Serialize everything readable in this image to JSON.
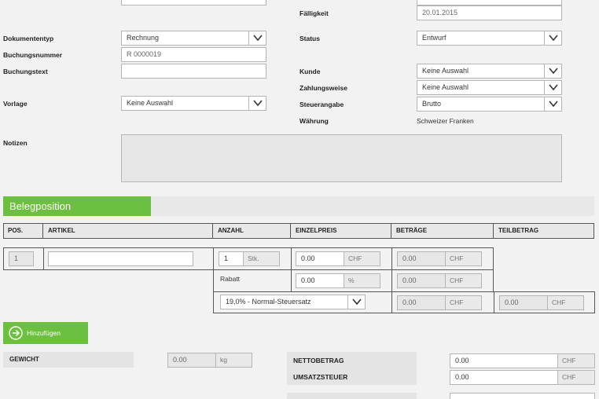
{
  "top": {
    "faelligkeit_label": "Fälligkeit",
    "faelligkeit_value": "20.01.2015"
  },
  "left_form": {
    "dokumententyp_label": "Dokumententyp",
    "dokumententyp_value": "Rechnung",
    "buchungsnummer_label": "Buchungsnummer",
    "buchungsnummer_value": "R 0000019",
    "buchungstext_label": "Buchungstext",
    "buchungstext_value": "",
    "vorlage_label": "Vorlage",
    "vorlage_value": "Keine Auswahl"
  },
  "right_form": {
    "status_label": "Status",
    "status_value": "Entwurf",
    "kunde_label": "Kunde",
    "kunde_value": "Keine Auswahl",
    "zahlungsweise_label": "Zahlungsweise",
    "zahlungsweise_value": "Keine Auswahl",
    "steuerangabe_label": "Steuerangabe",
    "steuerangabe_value": "Brutto",
    "waehrung_label": "Währung",
    "waehrung_value": "Schweizer Franken"
  },
  "notizen": {
    "label": "Notizen",
    "value": ""
  },
  "section": {
    "title": "Belegposition"
  },
  "table": {
    "headers": [
      "POS.",
      "ARTIKEL",
      "ANZAHL",
      "EINZELPREIS",
      "BETRÄGE",
      "TEILBETRAG"
    ],
    "row": {
      "pos": "1",
      "artikel": "",
      "anzahl": "1",
      "anzahl_unit": "Stk.",
      "einzelpreis": "0.00",
      "einzelpreis_unit": "CHF",
      "betrag": "0.00",
      "betrag_unit": "CHF"
    },
    "rabatt": {
      "label": "Rabatt",
      "value": "0.00",
      "unit": "%",
      "betrag": "0.00",
      "betrag_unit": "CHF"
    },
    "steuer": {
      "value": "19,0% - Normal-Steuersatz",
      "betrag": "0.00",
      "betrag_unit": "CHF",
      "teilbetrag": "0.00",
      "teilbetrag_unit": "CHF"
    }
  },
  "add_button": {
    "label": "Hinzufügen"
  },
  "summary": {
    "gewicht_label": "GEWICHT",
    "gewicht_value": "0.00",
    "gewicht_unit": "kg",
    "netto_label": "NETTOBETRAG",
    "netto_value": "0.00",
    "netto_unit": "CHF",
    "ust_label": "UMSATZSTEUER",
    "ust_value": "0.00",
    "ust_unit": "CHF"
  },
  "colors": {
    "accent": "#6cbf3f"
  }
}
